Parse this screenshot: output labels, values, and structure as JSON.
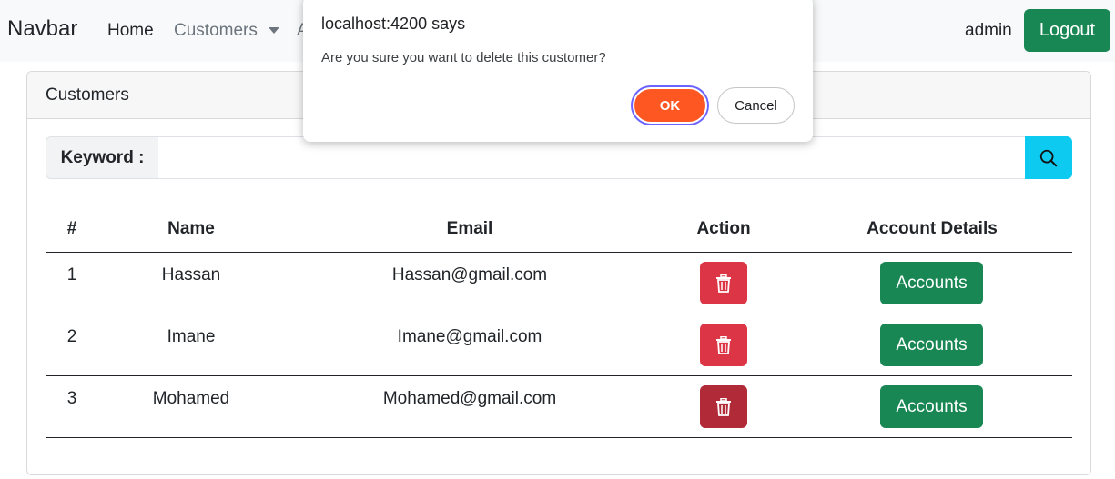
{
  "navbar": {
    "brand": "Navbar",
    "items": [
      {
        "label": "Home"
      },
      {
        "label": "Customers"
      },
      {
        "label": "Accounts"
      }
    ],
    "username": "admin",
    "logout_label": "Logout"
  },
  "card": {
    "title": "Customers",
    "search": {
      "label": "Keyword :",
      "value": "",
      "placeholder": ""
    }
  },
  "table": {
    "headers": [
      "#",
      "Name",
      "Email",
      "Action",
      "Account Details"
    ],
    "rows": [
      {
        "id": "1",
        "name": "Hassan",
        "email": "Hassan@gmail.com",
        "button": "Accounts"
      },
      {
        "id": "2",
        "name": "Imane",
        "email": "Imane@gmail.com",
        "button": "Accounts"
      },
      {
        "id": "3",
        "name": "Mohamed",
        "email": "Mohamed@gmail.com",
        "button": "Accounts"
      }
    ]
  },
  "dialog": {
    "title": "localhost:4200 says",
    "message": "Are you sure you want to delete this customer?",
    "ok_label": "OK",
    "cancel_label": "Cancel"
  },
  "colors": {
    "success": "#198754",
    "danger": "#dc3545",
    "info": "#0dcaf0",
    "ok_accent": "#ff5722"
  },
  "icons": {
    "search": "search-icon",
    "delete": "trash-icon",
    "dropdown": "caret-down-icon"
  }
}
